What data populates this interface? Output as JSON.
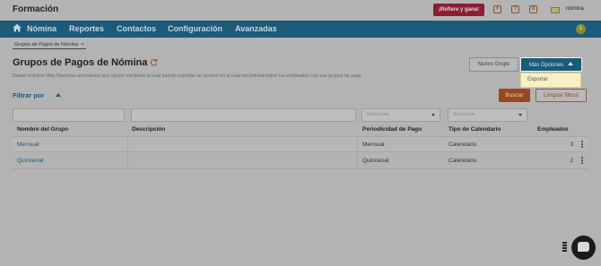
{
  "app": {
    "title": "Formación",
    "refiere_label": "¡Refiere y gana!",
    "icons": [
      "plus-icon",
      "help-icon",
      "notification-icon"
    ],
    "icon_glyphs": [
      "+",
      "?",
      "0"
    ],
    "username": "nómina"
  },
  "nav": {
    "items": [
      "Nómina",
      "Reportes",
      "Contactos",
      "Configuración",
      "Avanzadas"
    ],
    "badge": "1"
  },
  "breadcrumb": {
    "tab_label": "Grupos de Pagos de Nómina",
    "close": "×"
  },
  "page": {
    "title": "Grupos de Pagos de Nómina",
    "subtitle": "Desde el botón Más Opciones encontrará una opción mediante la cual podrás exportar un archivo en el cual encontrará todos tus empleados con sus grupos de pago",
    "nuevo_grupo": "Nuevo Grupo",
    "mas_opciones": "Más Opciones",
    "dropdown": {
      "items": [
        "Exportar"
      ]
    }
  },
  "filters": {
    "toggle_label": "Filtrar por",
    "buscar": "Buscar",
    "limpiar": "Limpiar filtros",
    "periodicidad_placeholder": "Selecciona",
    "tipo_placeholder": "Selecciona"
  },
  "table": {
    "headers": [
      "Nombre del Grupo",
      "Descripción",
      "Periodicidad de Pago",
      "Tipo de Calendario",
      "Empleados"
    ],
    "rows": [
      {
        "nombre": "Mensual",
        "descripcion": "",
        "periodicidad": "Mensual",
        "tipo": "Calendario",
        "empleados": "3"
      },
      {
        "nombre": "Quincenal",
        "descripcion": "",
        "periodicidad": "Quincenal",
        "tipo": "Calendario",
        "empleados": "2"
      }
    ]
  },
  "colors": {
    "nav": "#1c5a7a",
    "refiere": "#8a1f33",
    "buscar": "#9a4820",
    "dropdown": "#f6f0c2"
  }
}
